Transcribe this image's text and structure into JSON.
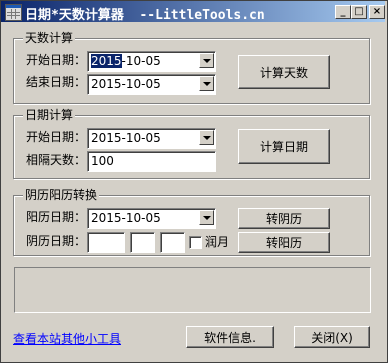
{
  "window": {
    "title": "日期*天数计算器  --LittleTools.cn",
    "minimize": "_",
    "maximize": "□",
    "close": "×"
  },
  "days_calc": {
    "group_label": "天数计算",
    "start_label": "开始日期：",
    "start_value_selected": "2015",
    "start_value_rest": "-10-05",
    "end_label": "结束日期：",
    "end_value": "2015-10-05",
    "button": "计算天数"
  },
  "date_calc": {
    "group_label": "日期计算",
    "start_label": "开始日期：",
    "start_value": "2015-10-05",
    "interval_label": "相隔天数：",
    "interval_value": "100",
    "button": "计算日期"
  },
  "lunar_convert": {
    "group_label": "阴历阳历转换",
    "solar_label": "阳历日期：",
    "solar_value": "2015-10-05",
    "to_lunar_button": "转阴历",
    "lunar_label": "阴历日期：",
    "lunar_year": "",
    "lunar_month": "",
    "lunar_day": "",
    "leap_label": "润月",
    "to_solar_button": "转阳历"
  },
  "footer": {
    "link": "查看本站其他小工具",
    "info_button": "软件信息.",
    "close_button": "关闭(X)"
  }
}
